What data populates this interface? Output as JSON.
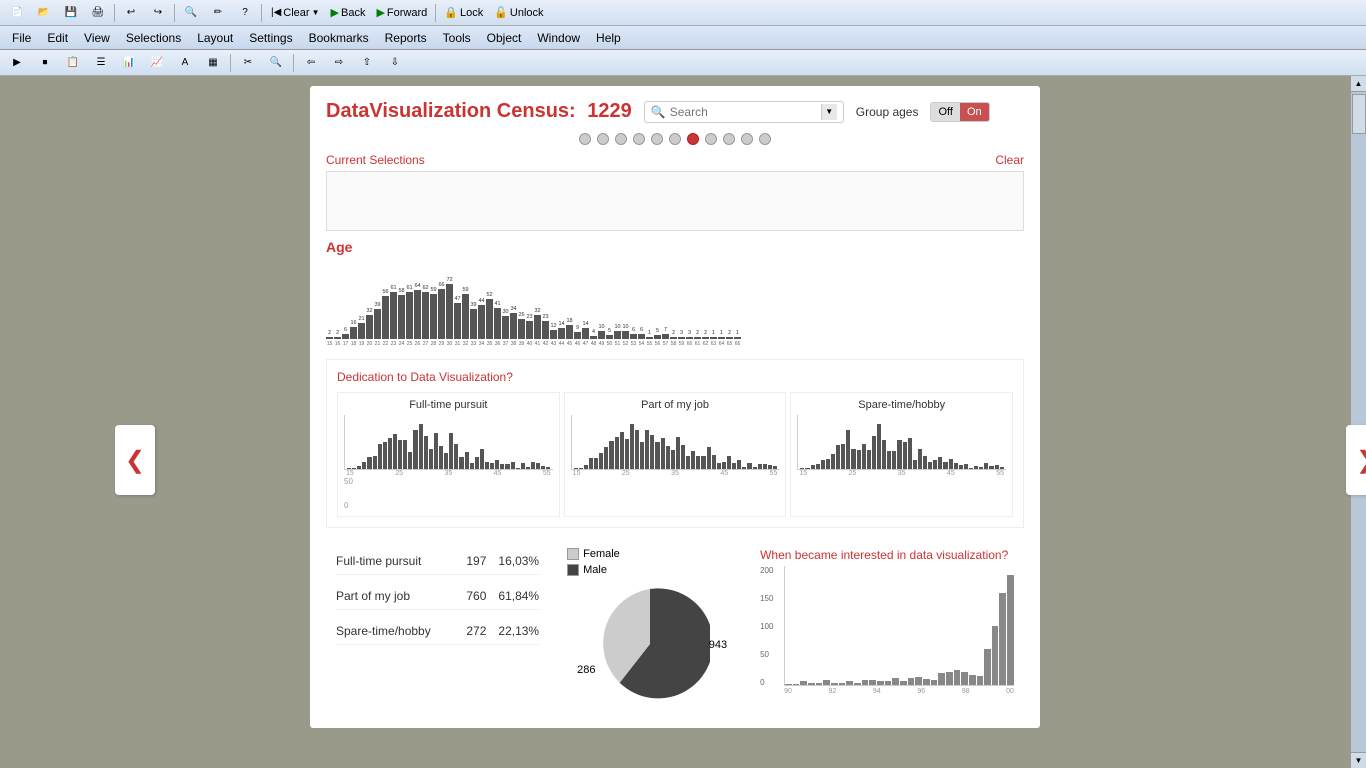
{
  "window": {
    "title": "DataVisualization Census"
  },
  "toolbar1": {
    "buttons": [
      "New",
      "Open",
      "Save",
      "Print",
      "Undo",
      "Redo",
      "Find",
      "Help"
    ],
    "clear_label": "Clear",
    "back_label": "Back",
    "forward_label": "Forward",
    "lock_label": "Lock",
    "unlock_label": "Unlock"
  },
  "menubar": {
    "items": [
      "File",
      "Edit",
      "View",
      "Selections",
      "Layout",
      "Settings",
      "Bookmarks",
      "Reports",
      "Tools",
      "Object",
      "Window",
      "Help"
    ]
  },
  "dashboard": {
    "title": "DataVisualization Census:",
    "count": "1229",
    "search_placeholder": "Search",
    "group_ages_label": "Group ages",
    "toggle_off": "Off",
    "toggle_on": "On",
    "current_selections_label": "Current Selections",
    "clear_label": "Clear",
    "age_title": "Age",
    "dedication_title": "Dedication to Data Visualization?",
    "chart1_title": "Full-time pursuit",
    "chart2_title": "Part of my job",
    "chart3_title": "Spare-time/hobby",
    "stats": [
      {
        "label": "Full-time pursuit",
        "count": "197",
        "percent": "16,03%"
      },
      {
        "label": "Part of my job",
        "count": "760",
        "percent": "61,84%"
      },
      {
        "label": "Spare-time/hobby",
        "count": "272",
        "percent": "22,13%"
      }
    ],
    "legend": [
      {
        "label": "Female",
        "color": "#cccccc"
      },
      {
        "label": "Male",
        "color": "#444444"
      }
    ],
    "female_count": "286",
    "male_count": "943",
    "timeline_title": "When became interested in data visualization?",
    "timeline_y_labels": [
      "200",
      "150",
      "100",
      "50",
      "0"
    ],
    "dots_count": 11,
    "active_dot": 7
  },
  "age_data": [
    {
      "age": "15",
      "val": 2,
      "count": "2"
    },
    {
      "age": "16",
      "val": 2,
      "count": "2"
    },
    {
      "age": "17",
      "val": 6,
      "count": "6"
    },
    {
      "age": "18",
      "val": 16,
      "count": "16"
    },
    {
      "age": "19",
      "val": 21,
      "count": "21"
    },
    {
      "age": "20",
      "val": 32,
      "count": "32"
    },
    {
      "age": "21",
      "val": 39,
      "count": "39"
    },
    {
      "age": "22",
      "val": 56,
      "count": "56"
    },
    {
      "age": "23",
      "val": 61,
      "count": "61"
    },
    {
      "age": "24",
      "val": 58,
      "count": "58"
    },
    {
      "age": "25",
      "val": 61,
      "count": "61"
    },
    {
      "age": "26",
      "val": 64,
      "count": "64"
    },
    {
      "age": "27",
      "val": 62,
      "count": "62"
    },
    {
      "age": "28",
      "val": 59,
      "count": "59"
    },
    {
      "age": "29",
      "val": 66,
      "count": "66"
    },
    {
      "age": "30",
      "val": 72,
      "count": "72"
    },
    {
      "age": "31",
      "val": 47,
      "count": "47"
    },
    {
      "age": "32",
      "val": 59,
      "count": "59"
    },
    {
      "age": "33",
      "val": 39,
      "count": "39"
    },
    {
      "age": "34",
      "val": 44,
      "count": "44"
    },
    {
      "age": "35",
      "val": 52,
      "count": "52"
    },
    {
      "age": "36",
      "val": 41,
      "count": "41"
    },
    {
      "age": "37",
      "val": 30,
      "count": "30"
    },
    {
      "age": "38",
      "val": 34,
      "count": "34"
    },
    {
      "age": "39",
      "val": 26,
      "count": "26"
    },
    {
      "age": "40",
      "val": 23,
      "count": "23"
    },
    {
      "age": "41",
      "val": 32,
      "count": "32"
    },
    {
      "age": "42",
      "val": 23,
      "count": "23"
    },
    {
      "age": "43",
      "val": 12,
      "count": "12"
    },
    {
      "age": "44",
      "val": 14,
      "count": "14"
    },
    {
      "age": "45",
      "val": 18,
      "count": "18"
    },
    {
      "age": "46",
      "val": 9,
      "count": "9"
    },
    {
      "age": "47",
      "val": 14,
      "count": "14"
    },
    {
      "age": "48",
      "val": 4,
      "count": "4"
    },
    {
      "age": "49",
      "val": 10,
      "count": "10"
    },
    {
      "age": "50",
      "val": 5,
      "count": "5"
    },
    {
      "age": "51",
      "val": 10,
      "count": "10"
    },
    {
      "age": "52",
      "val": 10,
      "count": "10"
    },
    {
      "age": "53",
      "val": 6,
      "count": "6"
    },
    {
      "age": "54",
      "val": 6,
      "count": "6"
    },
    {
      "age": "55",
      "val": 1,
      "count": "1"
    },
    {
      "age": "56",
      "val": 5,
      "count": "5"
    },
    {
      "age": "57",
      "val": 7,
      "count": "7"
    },
    {
      "age": "58",
      "val": 2,
      "count": "2"
    },
    {
      "age": "59",
      "val": 3,
      "count": "3"
    },
    {
      "age": "60",
      "val": 3,
      "count": "3"
    },
    {
      "age": "61",
      "val": 2,
      "count": "2"
    },
    {
      "age": "62",
      "val": 2,
      "count": "2"
    },
    {
      "age": "63",
      "val": 1,
      "count": "1"
    },
    {
      "age": "64",
      "val": 1,
      "count": "1"
    },
    {
      "age": "65",
      "val": 2,
      "count": "2"
    },
    {
      "age": "66",
      "val": 1,
      "count": "1"
    }
  ]
}
